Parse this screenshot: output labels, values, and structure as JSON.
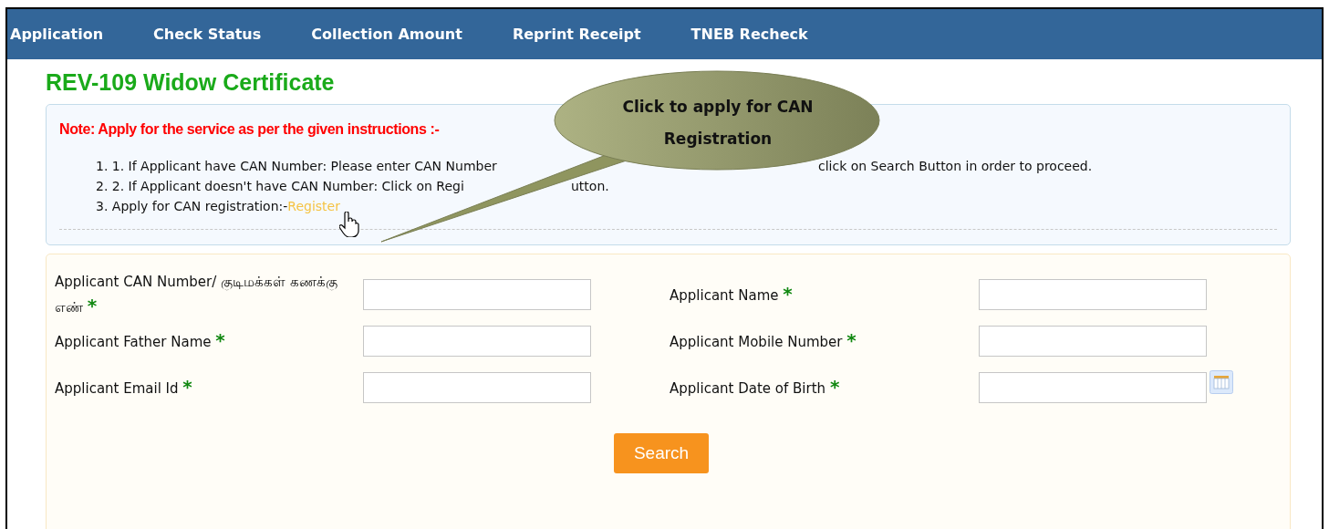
{
  "nav": {
    "items": [
      "Application",
      "Check Status",
      "Collection Amount",
      "Reprint Receipt",
      "TNEB Recheck"
    ]
  },
  "title": "REV-109 Widow Certificate",
  "note": {
    "heading": "Note: Apply for the service as per the given instructions :-",
    "items": [
      {
        "kind": "split",
        "parts": [
          "1. 1. If Applicant have CAN Number: Please enter CAN Number",
          "click on Search Button in order to proceed."
        ]
      },
      {
        "kind": "split",
        "parts": [
          "2. 2. If Applicant doesn't have CAN Number: Click on Regi",
          "utton."
        ]
      },
      {
        "kind": "link",
        "text": "3. Apply for CAN registration:-",
        "link": "Register"
      }
    ]
  },
  "callout": {
    "text": "Click to apply for CAN Registration"
  },
  "fields": [
    {
      "label": "Applicant CAN Number/ குடிமக்கள் கணக்கு எண்",
      "mark": "*",
      "kind": "text"
    },
    {
      "label": "Applicant Name",
      "mark": "*",
      "kind": "text"
    },
    {
      "label": "Applicant Father Name",
      "mark": "*",
      "kind": "text"
    },
    {
      "label": "Applicant Mobile Number",
      "mark": "*",
      "kind": "text"
    },
    {
      "label": "Applicant Email Id",
      "mark": "*",
      "kind": "text"
    },
    {
      "label": "Applicant Date of Birth",
      "mark": "*",
      "kind": "date"
    }
  ],
  "search_button": "Search"
}
